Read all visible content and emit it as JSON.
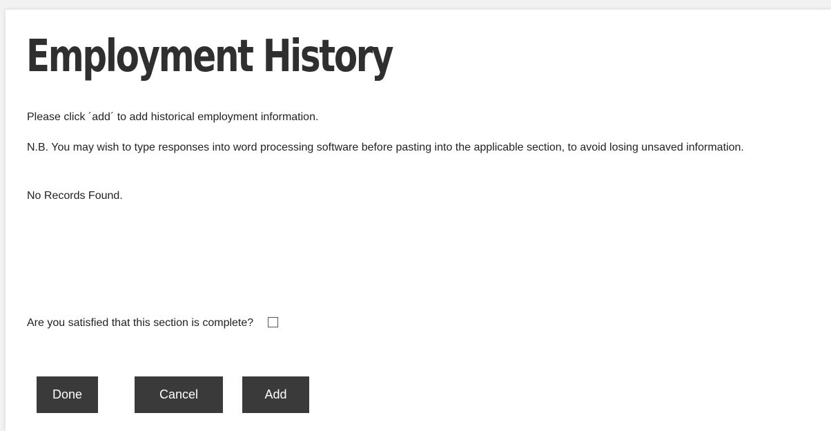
{
  "page": {
    "title": "Employment History",
    "instruction": "Please click ´add´ to add historical employment information.",
    "note": "N.B. You may wish to type responses into word processing software before pasting into the applicable section, to avoid losing unsaved information.",
    "no_records": "No Records Found.",
    "completion_question": "Are you satisfied that this section is complete?",
    "completion_checked": false
  },
  "actions": {
    "done_label": "Done",
    "cancel_label": "Cancel",
    "add_label": "Add"
  },
  "colors": {
    "title": "#2f2f2f",
    "button_bg": "#3a3a3a",
    "button_text": "#ffffff",
    "background": "#ffffff"
  }
}
